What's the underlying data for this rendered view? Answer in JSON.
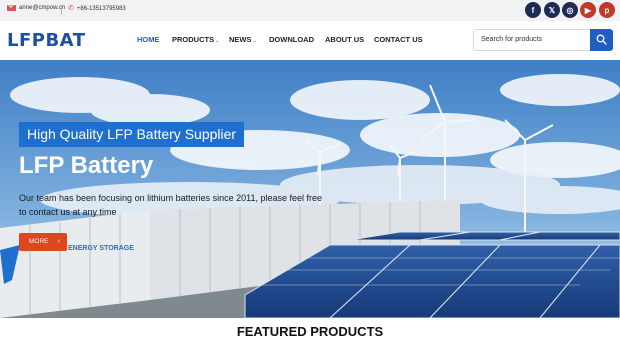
{
  "topbar": {
    "email": "anne@cmpow.cn",
    "phone": "+86-13513795983",
    "social": [
      {
        "icon": "facebook-icon",
        "glyph": "f"
      },
      {
        "icon": "x-icon",
        "glyph": "𝕏"
      },
      {
        "icon": "instagram-icon",
        "glyph": "◎"
      },
      {
        "icon": "youtube-icon",
        "glyph": "▶"
      },
      {
        "icon": "pinterest-icon",
        "glyph": "p"
      }
    ]
  },
  "header": {
    "logo": "LFPBAT",
    "nav": [
      {
        "label": "HOME",
        "active": true
      },
      {
        "label": "PRODUCTS",
        "dropdown": true
      },
      {
        "label": "NEWS",
        "dropdown": true
      },
      {
        "label": "DOWNLOAD"
      },
      {
        "label": "ABOUT US"
      },
      {
        "label": "CONTACT US"
      }
    ],
    "search": {
      "placeholder": "Search for products"
    },
    "caret": "⌄"
  },
  "hero": {
    "tagline": "High Quality LFP Battery Supplier",
    "title": "LFP Battery",
    "description": "Our team has been focusing on lithium batteries since 2011, please feel free to contact us at any time",
    "cta": "MORE",
    "cta_arrow": "›",
    "container_print": "ENERGY STORAGE"
  },
  "featured": {
    "title": "FEATURED PRODUCTS"
  },
  "colors": {
    "brand": "#1f4fa3",
    "accent": "#1f5fc2",
    "cta": "#e0461e"
  }
}
